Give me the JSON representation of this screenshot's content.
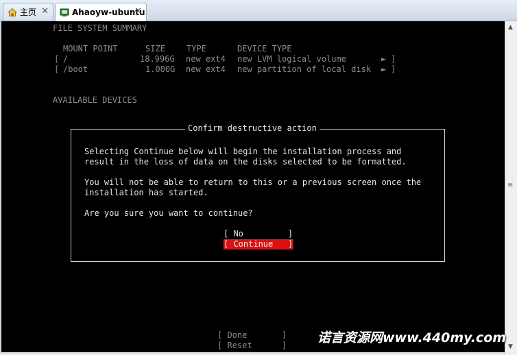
{
  "tabs": [
    {
      "label": "主页",
      "close": "✕",
      "icon": "home-icon"
    },
    {
      "label": "Ahaoyw-ubuntu",
      "close": "✕",
      "icon": "vm-icon"
    }
  ],
  "summary": {
    "heading": "FILE SYSTEM SUMMARY",
    "columns": {
      "mount_point": "MOUNT POINT",
      "size": "SIZE",
      "type": "TYPE",
      "device_type": "DEVICE TYPE"
    },
    "rows": [
      {
        "open": "[",
        "mount": "/",
        "size": "18.996G",
        "type": "new ext4",
        "device": "new LVM logical volume",
        "arrow": "►",
        "close": "]"
      },
      {
        "open": "[",
        "mount": "/boot",
        "size": "1.000G",
        "type": "new ext4",
        "device": "new partition of local disk",
        "arrow": "►",
        "close": "]"
      }
    ]
  },
  "available_devices": {
    "heading": "AVAILABLE DEVICES"
  },
  "dialog": {
    "title": "Confirm destructive action",
    "paragraph1": [
      "Selecting Continue below will begin the installation process and",
      "result in the loss of data on the disks selected to be formatted."
    ],
    "paragraph2": [
      "You will not be able to return to this or a previous screen once the",
      "installation has started."
    ],
    "question": "Are you sure you want to continue?",
    "buttons": {
      "no": "[ No         ]",
      "continue": "[ Continue   ]"
    }
  },
  "footer": {
    "done": "[ Done       ]",
    "reset": "[ Reset      ]"
  },
  "watermark": "诺言资源网www.440my.com",
  "colors": {
    "console_bg": "#000000",
    "selected_button_bg": "#e01010",
    "dim_text": "#8c8c8c"
  }
}
